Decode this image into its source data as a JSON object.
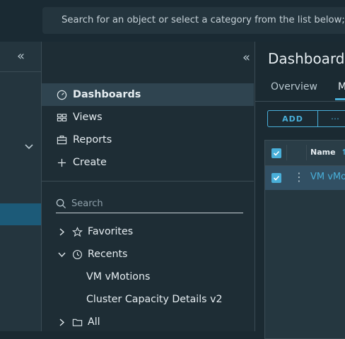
{
  "header": {
    "search_placeholder": "Search for an object or select a category from the list below; like"
  },
  "rail": {
    "collapse_icon": "double-chevron-left-icon",
    "expand_icon": "chevron-down-icon"
  },
  "nav": {
    "collapse_icon": "double-chevron-left-icon",
    "items": [
      {
        "label": "Dashboards",
        "icon": "dashboard-icon",
        "active": true
      },
      {
        "label": "Views",
        "icon": "views-icon"
      },
      {
        "label": "Reports",
        "icon": "reports-icon"
      },
      {
        "label": "Create",
        "icon": "plus-icon"
      }
    ],
    "search_placeholder": "Search",
    "tree": [
      {
        "label": "Favorites",
        "icon": "star-icon",
        "arrow": "chevron-right-icon"
      },
      {
        "label": "Recents",
        "icon": "history-icon",
        "arrow": "chevron-down-icon"
      },
      {
        "label": "VM vMotions"
      },
      {
        "label": "Cluster Capacity Details v2"
      },
      {
        "label": "All",
        "icon": "folder-icon",
        "arrow": "chevron-right-icon"
      }
    ]
  },
  "main": {
    "title": "Dashboards",
    "tabs": [
      {
        "label": "Overview",
        "active": false
      },
      {
        "label": "M",
        "active": true
      }
    ],
    "add_label": "ADD",
    "more_label": "⋯",
    "grid": {
      "columns": [
        "Name"
      ],
      "sort": "ascending",
      "rows": [
        {
          "name": "VM vMo",
          "selected": true
        }
      ],
      "header_checked": true
    },
    "accent": "#49afd9"
  }
}
